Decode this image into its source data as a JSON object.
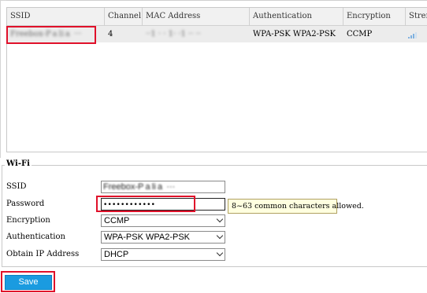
{
  "scan_table": {
    "columns": [
      "SSID",
      "Channel",
      "MAC Address",
      "Authentication",
      "Encryption",
      "Strength"
    ],
    "rows": [
      {
        "ssid": "Freebox-P a li a  ···",
        "channel": "4",
        "mac": "··1 · · 1· ·1 ·· ··",
        "authentication": "WPA-PSK WPA2-PSK",
        "encryption": "CCMP",
        "strength_bars_filled": 3,
        "strength_bars_total": 4
      }
    ]
  },
  "wifi": {
    "legend": "Wi-Fi",
    "ssid_label": "SSID",
    "ssid_value": "Freebox-P a li a  ···",
    "password_label": "Password",
    "password_value": "••••••••••••",
    "password_hint": "8~63 common characters allowed.",
    "encryption_label": "Encryption",
    "encryption_value": "CCMP",
    "authentication_label": "Authentication",
    "authentication_value": "WPA-PSK WPA2-PSK",
    "obtain_ip_label": "Obtain IP Address",
    "obtain_ip_value": "DHCP"
  },
  "actions": {
    "save_label": "Save"
  },
  "colors": {
    "highlight_box": "#e0102a",
    "save_button": "#1a9be0",
    "tooltip_bg": "#ffffe0",
    "signal": "#7fb1e0"
  }
}
